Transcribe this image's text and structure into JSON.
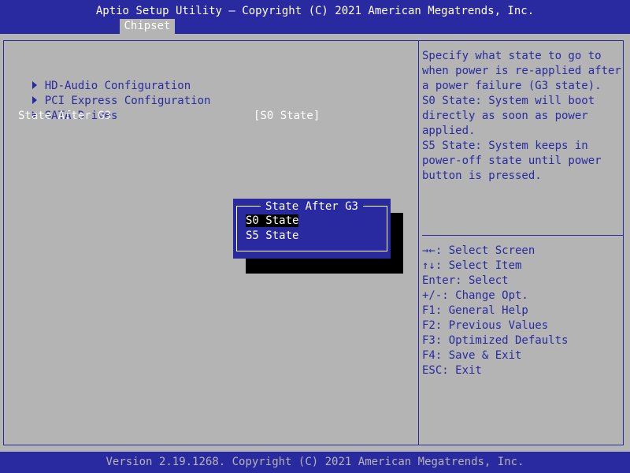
{
  "header": {
    "title": "Aptio Setup Utility – Copyright (C) 2021 American Megatrends, Inc.",
    "tab": "Chipset"
  },
  "menu": {
    "items": [
      {
        "label": "HD-Audio Configuration"
      },
      {
        "label": "PCI Express Configuration"
      },
      {
        "label": "SATA Drives"
      }
    ],
    "setting": {
      "label": "State After G3",
      "value": "[S0 State]"
    }
  },
  "help": {
    "description": [
      "Specify what state to go to",
      "when power is re-applied after",
      "a power failure (G3 state).",
      "S0 State: System will boot",
      "directly as soon as power",
      "applied.",
      "S5 State: System keeps in",
      "power-off state until power",
      "button is pressed."
    ],
    "keys": [
      "→←: Select Screen",
      "↑↓: Select Item",
      "Enter: Select",
      "+/-: Change Opt.",
      "F1: General Help",
      "F2: Previous Values",
      "F3: Optimized Defaults",
      "F4: Save & Exit",
      "ESC: Exit"
    ]
  },
  "popup": {
    "title": "State After G3",
    "options": [
      "S0 State",
      "S5 State"
    ],
    "selected": "S0 State"
  },
  "footer": {
    "text": "Version 2.19.1268. Copyright (C) 2021 American Megatrends, Inc."
  },
  "colors": {
    "blue": "#2a2aa0",
    "gray": "#b4b4b4",
    "white": "#ffffff",
    "black": "#000000"
  }
}
